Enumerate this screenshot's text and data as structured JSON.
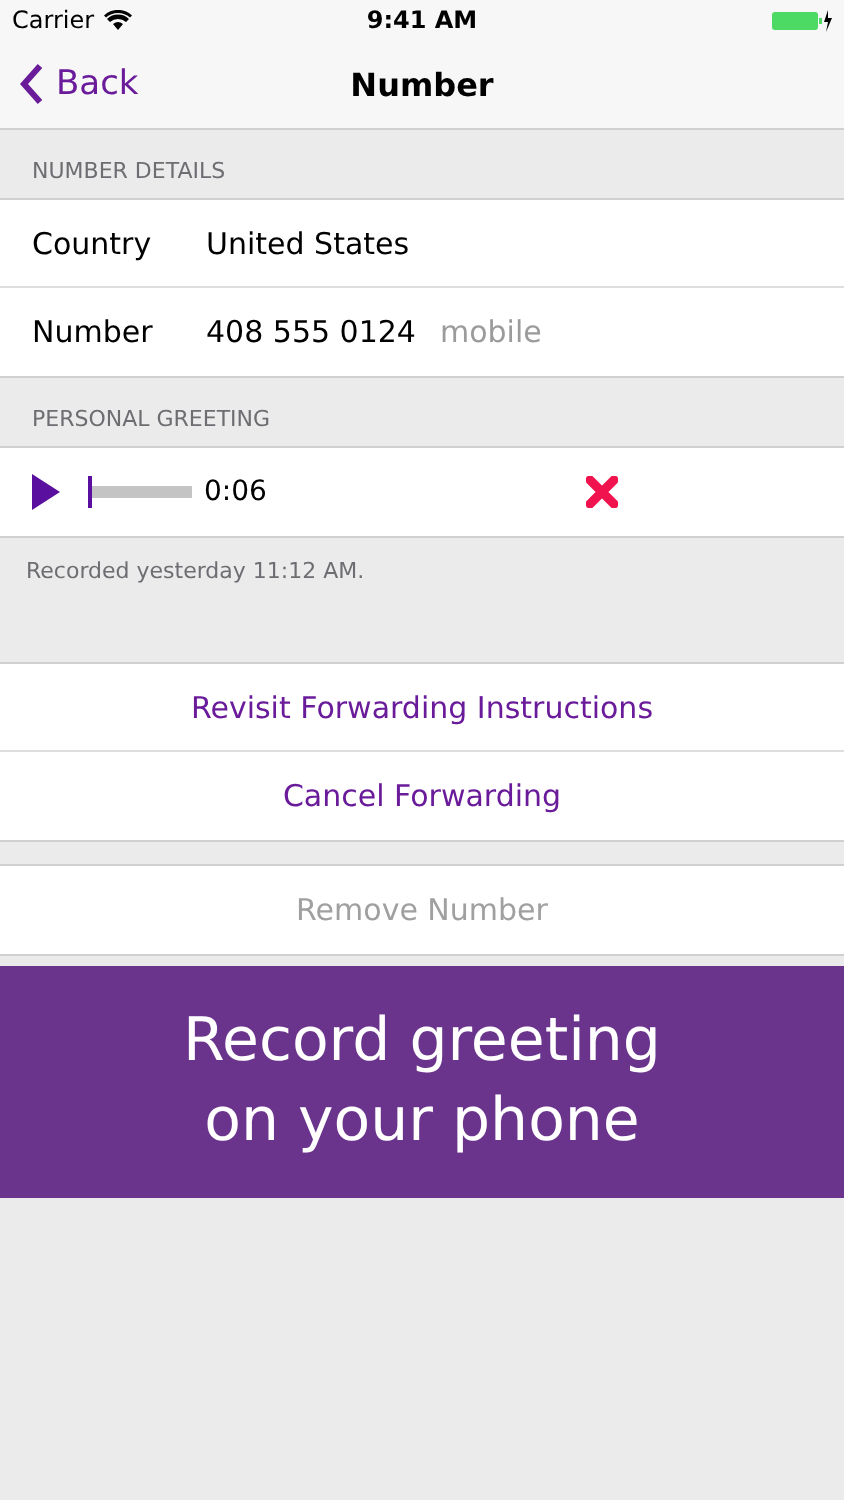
{
  "status_bar": {
    "carrier": "Carrier",
    "time": "9:41 AM"
  },
  "nav": {
    "back": "Back",
    "title": "Number"
  },
  "sections": [
    {
      "header": "NUMBER DETAILS",
      "rows": [
        {
          "label": "Country",
          "value": "United States"
        },
        {
          "label": "Number",
          "value": "408 555 0124",
          "note": "mobile"
        }
      ]
    },
    {
      "header": "PERSONAL GREETING",
      "player": {
        "level": 0,
        "time": "0:06"
      },
      "footer": "Recorded yesterday 11:12 AM."
    }
  ],
  "actions": [
    {
      "label": "Revisit Forwarding Instructions",
      "disabled": false
    },
    {
      "label": "Cancel Forwarding",
      "disabled": false
    }
  ],
  "remove": {
    "label": "Remove Number",
    "disabled": true
  },
  "banner": [
    "Record greeting",
    "on your phone"
  ]
}
